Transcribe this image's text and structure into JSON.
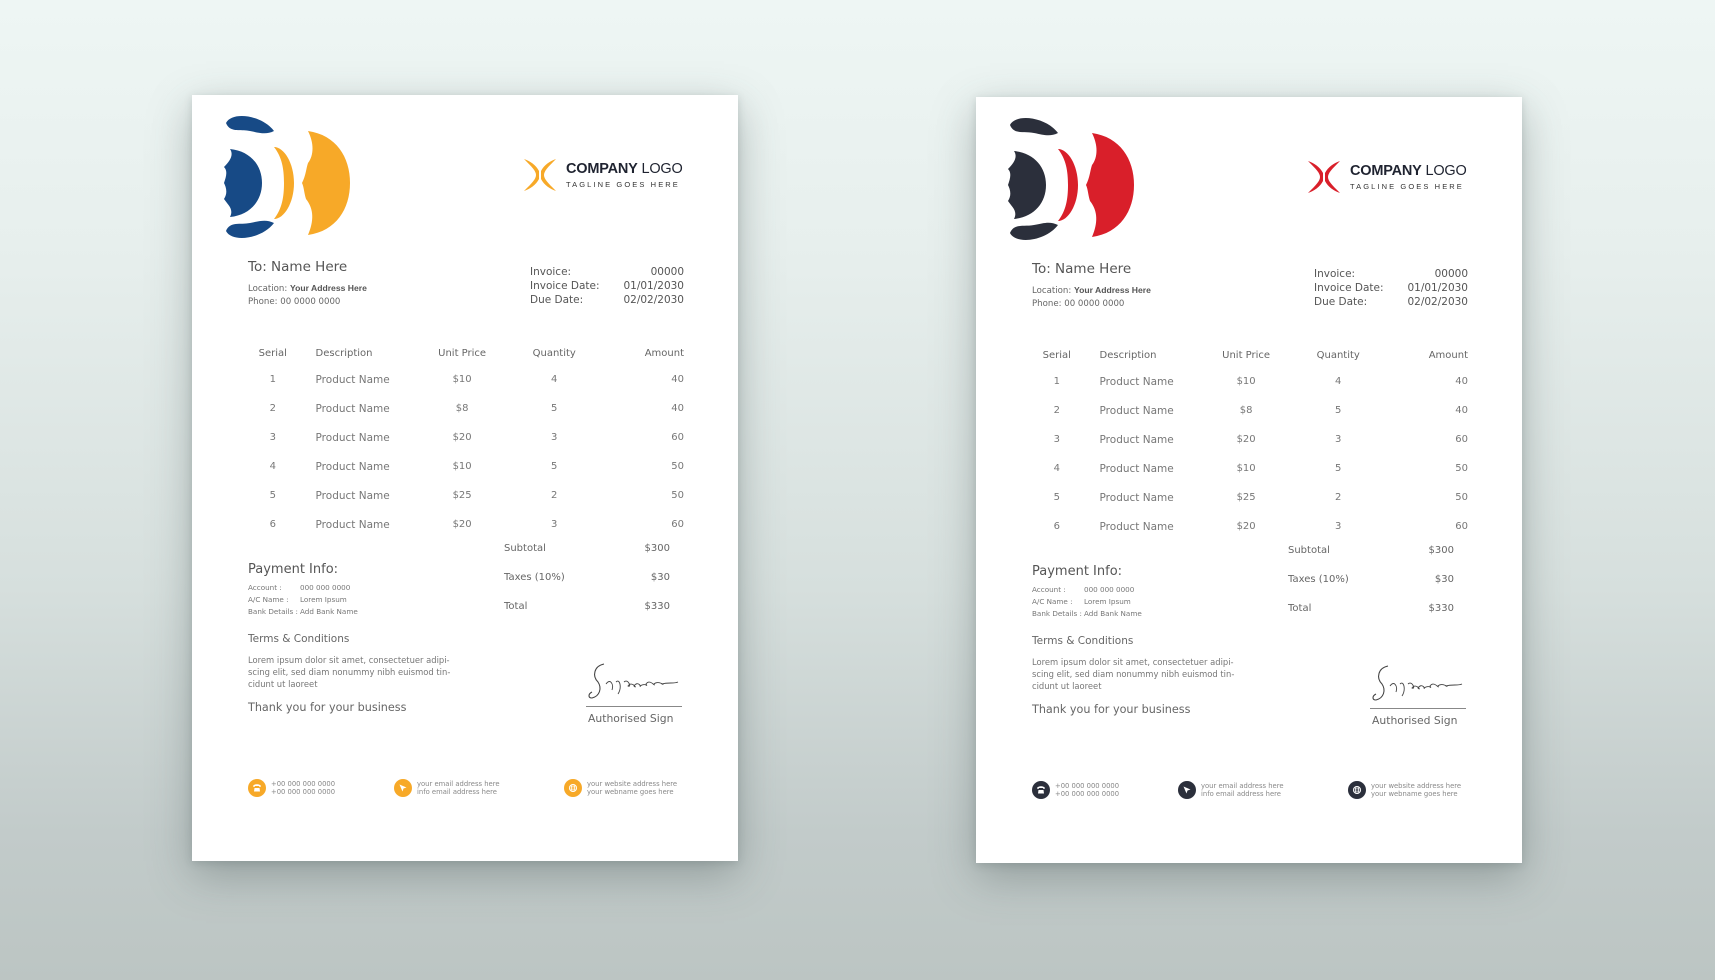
{
  "scene": "Two invoice template mockups on a soft gradient background",
  "invoices": [
    {
      "variant": "yellow-blue",
      "colors": {
        "primary": "#f7a928",
        "secondary": "#174a86",
        "text_dark": "#1f2330"
      },
      "brand": {
        "name_bold": "COMPANY",
        "name_light": "LOGO",
        "tagline": "TAGLINE GOES HERE"
      },
      "to": {
        "name": "To: Name Here",
        "location_label": "Location:",
        "location_value": "Your Address Here",
        "phone": "Phone: 00 0000 0000"
      },
      "meta": [
        {
          "label": "Invoice:",
          "value": "00000"
        },
        {
          "label": "Invoice Date:",
          "value": "01/01/2030"
        },
        {
          "label": "Due Date:",
          "value": "02/02/2030"
        }
      ],
      "table": {
        "headers": [
          "Serial",
          "Description",
          "Unit Price",
          "Quantity",
          "Amount"
        ],
        "rows": [
          [
            "1",
            "Product Name",
            "$10",
            "4",
            "40"
          ],
          [
            "2",
            "Product Name",
            "$8",
            "5",
            "40"
          ],
          [
            "3",
            "Product Name",
            "$20",
            "3",
            "60"
          ],
          [
            "4",
            "Product Name",
            "$10",
            "5",
            "50"
          ],
          [
            "5",
            "Product Name",
            "$25",
            "2",
            "50"
          ],
          [
            "6",
            "Product Name",
            "$20",
            "3",
            "60"
          ]
        ]
      },
      "totals": [
        {
          "label": "Subtotal",
          "value": "$300"
        },
        {
          "label": "Taxes (10%)",
          "value": "$30"
        },
        {
          "label": "Total",
          "value": "$330"
        }
      ],
      "payment": {
        "title": "Payment Info:",
        "lines": [
          {
            "label": "Account :",
            "value": "000 000 0000"
          },
          {
            "label": "A/C Name :",
            "value": "Lorem Ipsum"
          },
          {
            "label": "Bank Details :",
            "value": "Add Bank Name"
          }
        ]
      },
      "terms": {
        "title": "Terms & Conditions",
        "body": "Lorem ipsum dolor sit amet, consectetuer adipi-scing elit, sed diam nonummy nibh euismod tin-cidunt ut laoreet"
      },
      "thanks": "Thank you for your business",
      "signature": {
        "script": "Signature",
        "label": "Authorised Sign"
      },
      "footer": [
        {
          "icon": "phone-icon",
          "line1": "+00 000 000 0000",
          "line2": "+00 000 000 0000"
        },
        {
          "icon": "send-icon",
          "line1": "your email address here",
          "line2": "info email address here"
        },
        {
          "icon": "globe-icon",
          "line1": "your website address here",
          "line2": "your webname goes here"
        }
      ]
    },
    {
      "variant": "red-navy",
      "colors": {
        "primary": "#d91f2a",
        "secondary": "#2b2f3b",
        "text_dark": "#1f2330"
      },
      "brand": {
        "name_bold": "COMPANY",
        "name_light": "LOGO",
        "tagline": "TAGLINE GOES HERE"
      },
      "to": {
        "name": "To: Name Here",
        "location_label": "Location:",
        "location_value": "Your Address Here",
        "phone": "Phone: 00 0000 0000"
      },
      "meta": [
        {
          "label": "Invoice:",
          "value": "00000"
        },
        {
          "label": "Invoice Date:",
          "value": "01/01/2030"
        },
        {
          "label": "Due Date:",
          "value": "02/02/2030"
        }
      ],
      "table": {
        "headers": [
          "Serial",
          "Description",
          "Unit Price",
          "Quantity",
          "Amount"
        ],
        "rows": [
          [
            "1",
            "Product Name",
            "$10",
            "4",
            "40"
          ],
          [
            "2",
            "Product Name",
            "$8",
            "5",
            "40"
          ],
          [
            "3",
            "Product Name",
            "$20",
            "3",
            "60"
          ],
          [
            "4",
            "Product Name",
            "$10",
            "5",
            "50"
          ],
          [
            "5",
            "Product Name",
            "$25",
            "2",
            "50"
          ],
          [
            "6",
            "Product Name",
            "$20",
            "3",
            "60"
          ]
        ]
      },
      "totals": [
        {
          "label": "Subtotal",
          "value": "$300"
        },
        {
          "label": "Taxes (10%)",
          "value": "$30"
        },
        {
          "label": "Total",
          "value": "$330"
        }
      ],
      "payment": {
        "title": "Payment Info:",
        "lines": [
          {
            "label": "Account :",
            "value": "000 000 0000"
          },
          {
            "label": "A/C Name :",
            "value": "Lorem Ipsum"
          },
          {
            "label": "Bank Details :",
            "value": "Add Bank Name"
          }
        ]
      },
      "terms": {
        "title": "Terms & Conditions",
        "body": "Lorem ipsum dolor sit amet, consectetuer adipi-scing elit, sed diam nonummy nibh euismod tin-cidunt ut laoreet"
      },
      "thanks": "Thank you for your business",
      "signature": {
        "script": "Signature",
        "label": "Authorised Sign"
      },
      "footer": [
        {
          "icon": "phone-icon",
          "line1": "+00 000 000 0000",
          "line2": "+00 000 000 0000"
        },
        {
          "icon": "send-icon",
          "line1": "your email address here",
          "line2": "info email address here"
        },
        {
          "icon": "globe-icon",
          "line1": "your website address here",
          "line2": "your webname goes here"
        }
      ]
    }
  ]
}
